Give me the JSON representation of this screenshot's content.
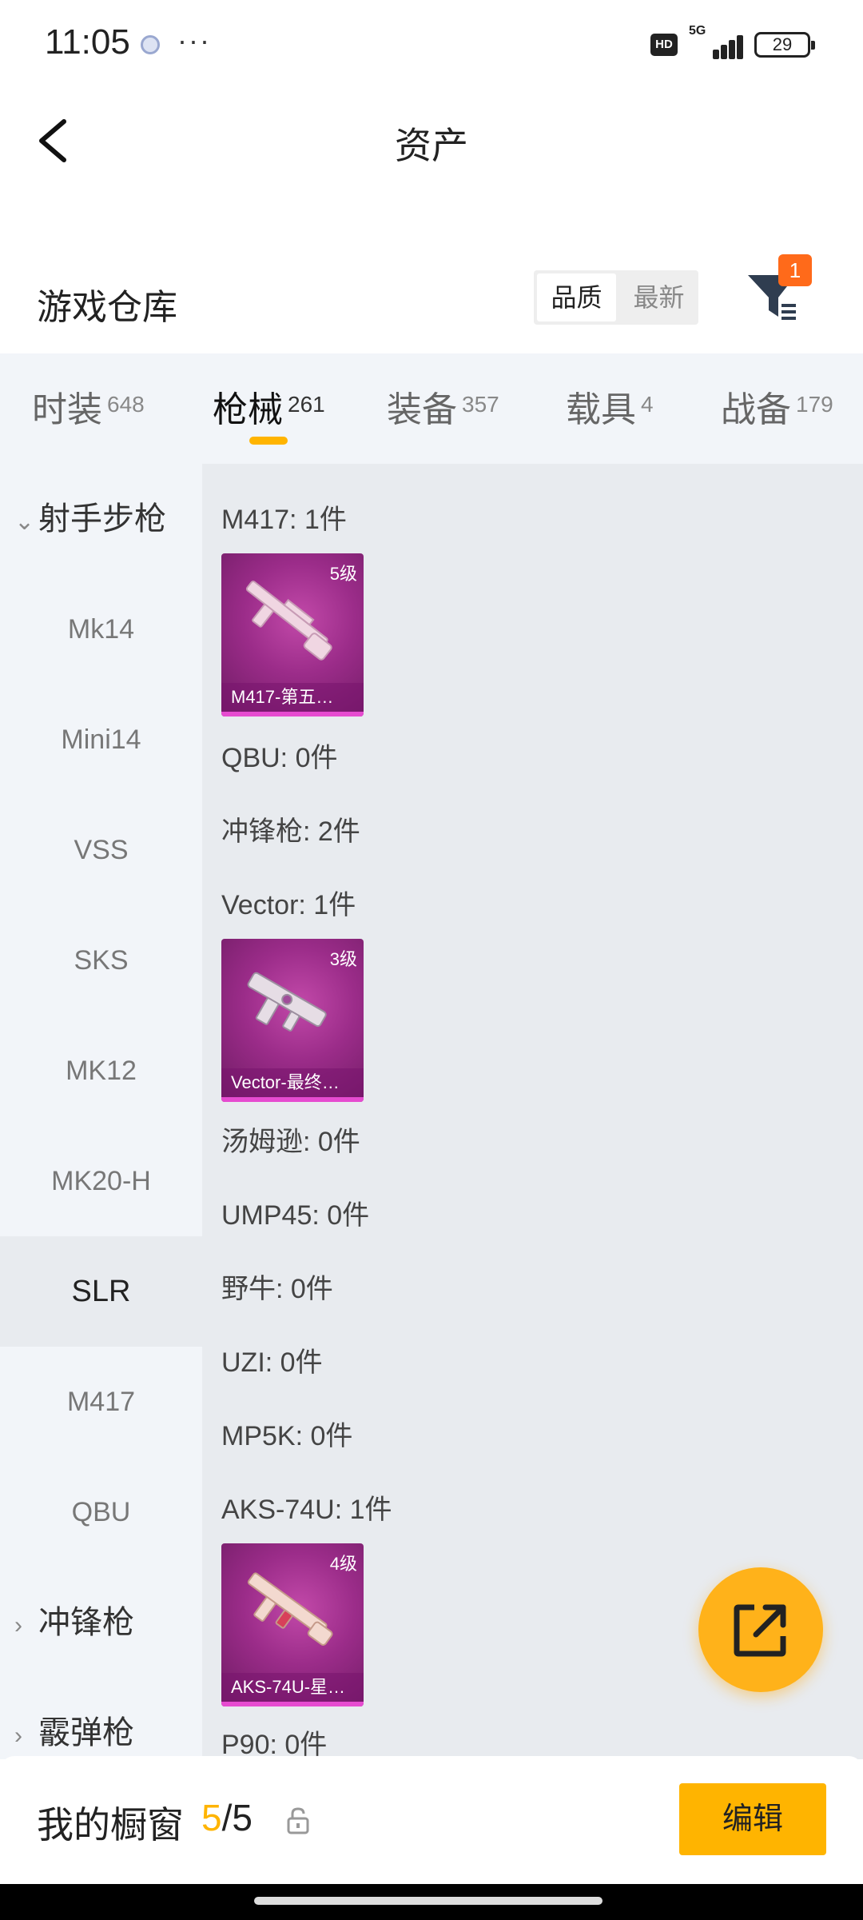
{
  "status_bar": {
    "time": "11:05",
    "more": "···",
    "hd": "HD",
    "network": "5G",
    "battery": "29"
  },
  "header": {
    "title": "资产"
  },
  "warehouse": {
    "title": "游戏仓库",
    "sort_options": [
      "品质",
      "最新"
    ],
    "filter_badge": "1"
  },
  "tabs": [
    {
      "label": "时装",
      "count": "648"
    },
    {
      "label": "枪械",
      "count": "261"
    },
    {
      "label": "装备",
      "count": "357"
    },
    {
      "label": "载具",
      "count": "4"
    },
    {
      "label": "战备",
      "count": "179"
    }
  ],
  "sidebar": {
    "group_open": "射手步枪",
    "items": [
      "Mk14",
      "Mini14",
      "VSS",
      "SKS",
      "MK12",
      "MK20-H",
      "SLR",
      "M417",
      "QBU"
    ],
    "groups_closed": [
      "冲锋枪",
      "霰弹枪"
    ]
  },
  "content": {
    "rows": [
      "M417: 1件",
      "QBU: 0件",
      "冲锋枪: 2件",
      "Vector: 1件",
      "汤姆逊: 0件",
      "UMP45: 0件",
      "野牛: 0件",
      "UZI: 0件",
      "MP5K: 0件",
      "AKS-74U: 1件",
      "P90: 0件"
    ],
    "cards": [
      {
        "level": "5级",
        "name": "M417-第五…"
      },
      {
        "level": "3级",
        "name": "Vector-最终…"
      },
      {
        "level": "4级",
        "name": "AKS-74U-星…"
      }
    ]
  },
  "bottom_bar": {
    "label": "我的橱窗",
    "current": "5",
    "total": "/5",
    "edit": "编辑"
  }
}
